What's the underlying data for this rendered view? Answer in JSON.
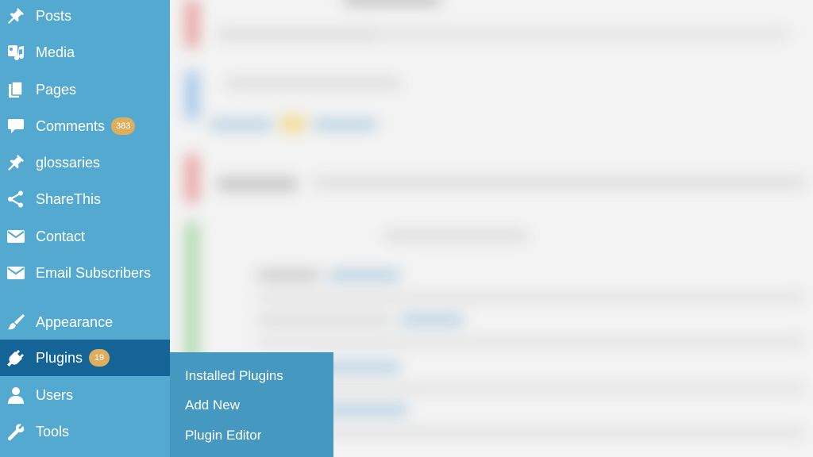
{
  "colors": {
    "sidebar_bg": "#54a9d1",
    "active_bg": "#146497",
    "submenu_bg": "#4598c0",
    "badge_bg": "#dcae5e",
    "text": "#ffffff"
  },
  "sidebar": {
    "items": [
      {
        "label": "Posts",
        "icon": "pin-icon"
      },
      {
        "label": "Media",
        "icon": "media-icon"
      },
      {
        "label": "Pages",
        "icon": "pages-icon"
      },
      {
        "label": "Comments",
        "icon": "comment-icon",
        "badge": "383"
      },
      {
        "label": "glossaries",
        "icon": "pin-icon"
      },
      {
        "label": "ShareThis",
        "icon": "share-icon"
      },
      {
        "label": "Contact",
        "icon": "mail-icon"
      },
      {
        "label": "Email Subscribers",
        "icon": "mail-icon"
      },
      {
        "label": "Appearance",
        "icon": "brush-icon"
      },
      {
        "label": "Plugins",
        "icon": "plug-icon",
        "badge": "19",
        "active": true
      },
      {
        "label": "Users",
        "icon": "user-icon"
      },
      {
        "label": "Tools",
        "icon": "wrench-icon"
      }
    ]
  },
  "submenu": {
    "items": [
      {
        "label": "Installed Plugins"
      },
      {
        "label": "Add New"
      },
      {
        "label": "Plugin Editor"
      }
    ]
  }
}
